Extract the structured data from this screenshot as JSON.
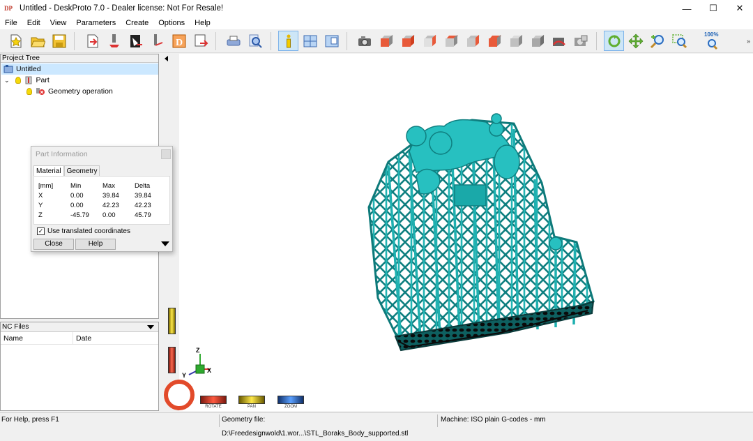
{
  "window": {
    "title": "Untitled - DeskProto 7.0 - Dealer license: Not For Resale!",
    "app_icon_text": "DP",
    "controls": {
      "minimize": "—",
      "maximize": "☐",
      "close": "✕"
    }
  },
  "menu": [
    "File",
    "Edit",
    "View",
    "Parameters",
    "Create",
    "Options",
    "Help"
  ],
  "toolbar": {
    "zoom_label": "100%",
    "accent": "#1a5fb4",
    "buttons": [
      "new-project-icon",
      "open-folder-icon",
      "save-icon",
      "import-geometry-icon",
      "mill-tool-icon",
      "vector-layout-icon",
      "bitmap-icon",
      "text-d-icon",
      "export-icon",
      "print-icon",
      "preview-icon",
      "part-information-icon",
      "layout-view-icon",
      "multi-view-icon",
      "camera-view-icon",
      "view-front-icon",
      "view-back-icon",
      "view-left-icon",
      "view-right-icon",
      "view-top-icon",
      "view-bottom-icon",
      "view-iso-icon",
      "view-iso2-icon",
      "reset-view-icon",
      "copy-view-icon",
      "rotate-icon",
      "pan-icon",
      "zoom-in-icon",
      "zoom-window-icon",
      "zoom-100-icon"
    ]
  },
  "project_tree": {
    "header": "Project Tree",
    "items": [
      {
        "label": "Untitled"
      },
      {
        "label": "Part"
      },
      {
        "label": "Geometry operation"
      }
    ]
  },
  "nc_files": {
    "header": "NC Files",
    "columns": [
      "Name",
      "Date"
    ]
  },
  "part_info": {
    "title": "Part Information",
    "tabs": [
      "Material",
      "Geometry"
    ],
    "table": {
      "header": [
        "[mm]",
        "Min",
        "Max",
        "Delta"
      ],
      "rows": [
        [
          "X",
          "0.00",
          "39.84",
          "39.84"
        ],
        [
          "Y",
          "0.00",
          "42.23",
          "42.23"
        ],
        [
          "Z",
          "-45.79",
          "0.00",
          "45.79"
        ]
      ]
    },
    "checkbox_label": "Use translated coordinates",
    "checkbox_checked": true,
    "close_label": "Close",
    "help_label": "Help"
  },
  "viewport": {
    "model_color": "#1fb2b2",
    "axes": {
      "z": "Z",
      "x": "X",
      "y": "Y"
    },
    "modes": [
      "ROTATE",
      "PAN",
      "ZOOM"
    ]
  },
  "status": {
    "help": "For Help, press F1",
    "geometry": "Geometry file: D:\\Freedesignwold\\1.wor...\\STL_Boraks_Body_supported.stl",
    "machine": "Machine: ISO plain G-codes - mm"
  }
}
